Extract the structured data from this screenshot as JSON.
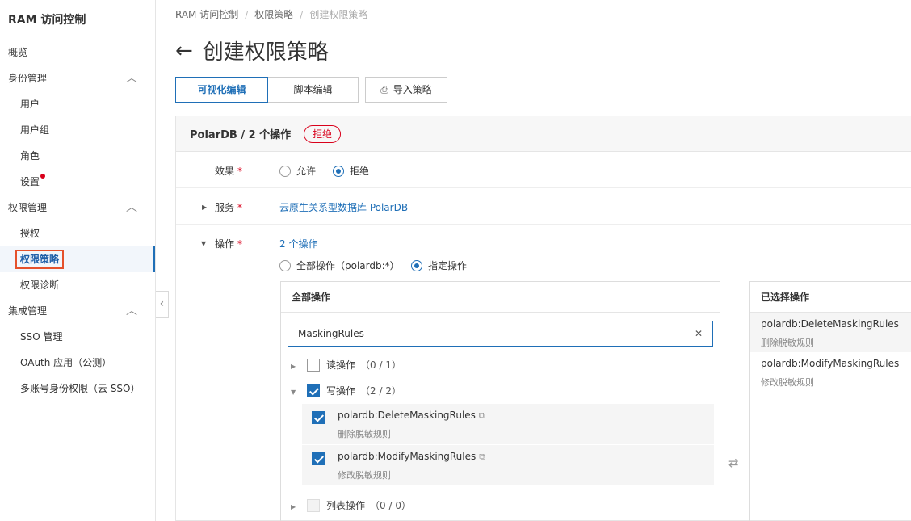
{
  "sidebar": {
    "brand": "RAM 访问控制",
    "items": [
      {
        "label": "概览"
      },
      {
        "label": "身份管理"
      },
      {
        "label": "用户"
      },
      {
        "label": "用户组"
      },
      {
        "label": "角色"
      },
      {
        "label": "设置"
      },
      {
        "label": "权限管理"
      },
      {
        "label": "授权"
      },
      {
        "label": "权限策略"
      },
      {
        "label": "权限诊断"
      },
      {
        "label": "集成管理"
      },
      {
        "label": "SSO 管理"
      },
      {
        "label": "OAuth 应用（公测）"
      },
      {
        "label": "多账号身份权限（云 SSO）"
      }
    ]
  },
  "breadcrumb": [
    "RAM 访问控制",
    "权限策略",
    "创建权限策略"
  ],
  "page_title": "创建权限策略",
  "tabs": {
    "visual": "可视化编辑",
    "script": "脚本编辑",
    "import": "导入策略"
  },
  "statement": {
    "title": "PolarDB / 2 个操作",
    "badge": "拒绝",
    "effect_label": "效果",
    "effect_allow": "允许",
    "effect_deny": "拒绝",
    "service_label": "服务",
    "service_value": "云原生关系型数据库 PolarDB",
    "action_label": "操作",
    "action_count": "2 个操作",
    "all_actions_option": "全部操作（polardb:*）",
    "specified_option": "指定操作"
  },
  "all_actions": {
    "header": "全部操作",
    "search_value": "MaskingRules",
    "groups": [
      {
        "label": "读操作",
        "count": "（0 / 1）"
      },
      {
        "label": "写操作",
        "count": "（2 / 2）"
      },
      {
        "label": "列表操作",
        "count": "（0 / 0）"
      }
    ],
    "items": [
      {
        "name": "polardb:DeleteMaskingRules",
        "desc": "删除脱敏规则"
      },
      {
        "name": "polardb:ModifyMaskingRules",
        "desc": "修改脱敏规则"
      }
    ]
  },
  "selected_actions": {
    "header": "已选择操作",
    "items": [
      {
        "name": "polardb:DeleteMaskingRules",
        "desc": "删除脱敏规则"
      },
      {
        "name": "polardb:ModifyMaskingRules",
        "desc": "修改脱敏规则"
      }
    ]
  },
  "colors": {
    "accent": "#1f6fb7",
    "deny": "#d9001b",
    "highlight": "#e5512b"
  }
}
